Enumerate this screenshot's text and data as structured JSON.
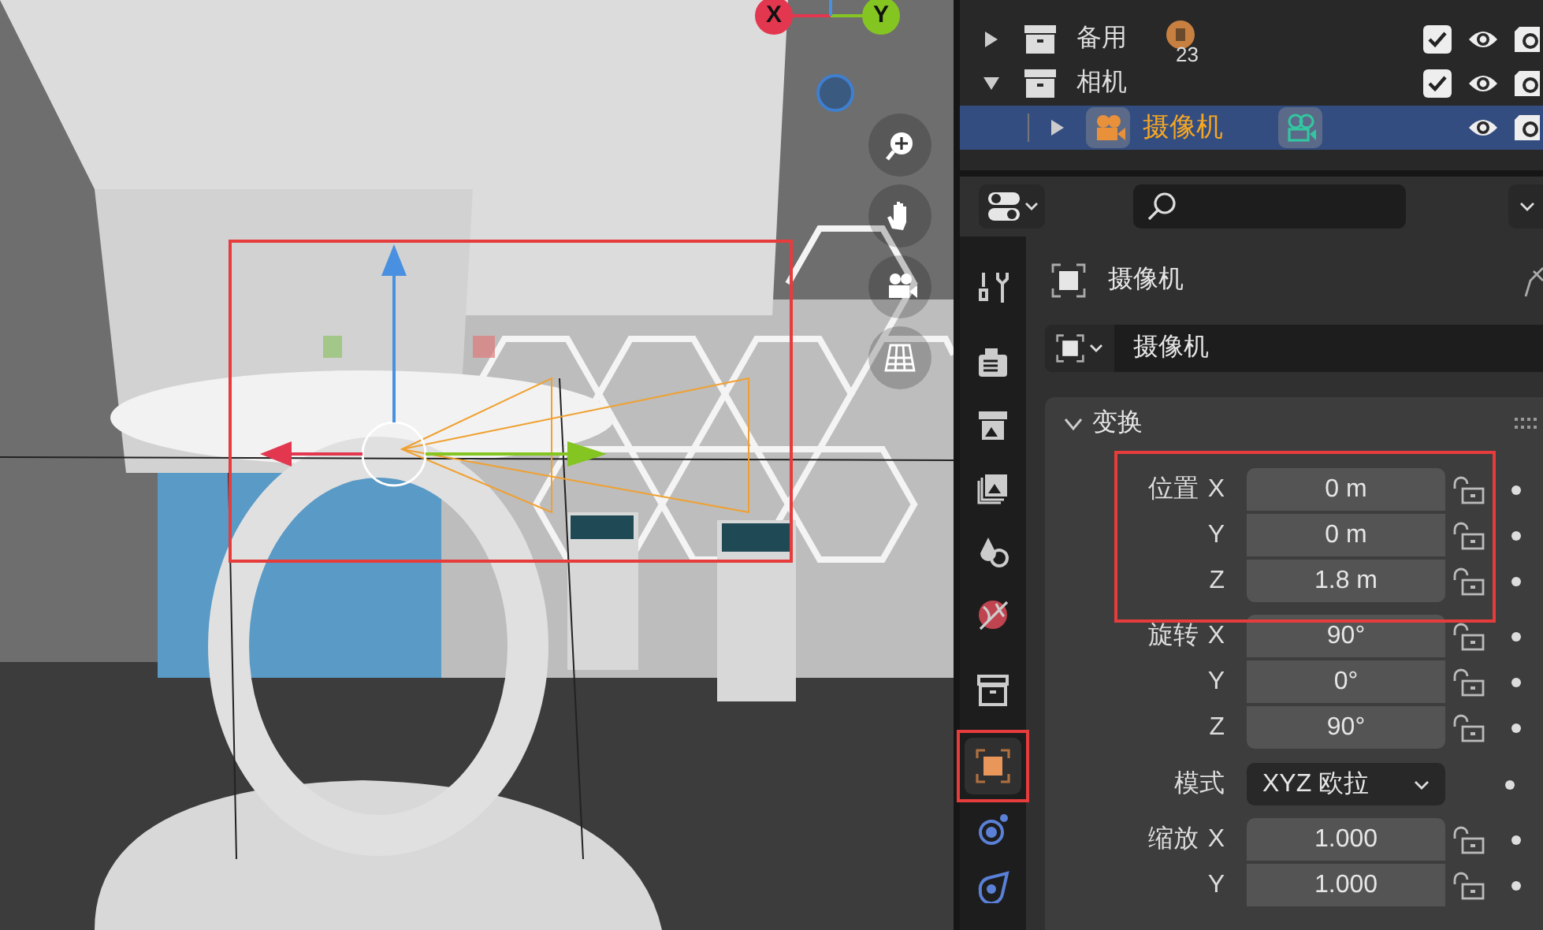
{
  "viewport": {
    "gizmo": [
      {
        "label": "X",
        "color": "#e2374f"
      },
      {
        "label": "Y",
        "color": "#84c522"
      }
    ]
  },
  "outliner": {
    "rows": [
      {
        "kind": "collection",
        "label": "备用",
        "expanded": false,
        "checked": true,
        "count": "23",
        "selected": false
      },
      {
        "kind": "collection",
        "label": "相机",
        "expanded": true,
        "checked": true,
        "selected": false
      },
      {
        "kind": "object",
        "label": "摄像机",
        "expanded": false,
        "selected": true
      }
    ]
  },
  "properties": {
    "tabs": [
      {
        "kind": "tool",
        "selected": false
      },
      {
        "kind": "render",
        "selected": false
      },
      {
        "kind": "output",
        "selected": false
      },
      {
        "kind": "view_layer",
        "selected": false
      },
      {
        "kind": "scene",
        "selected": false
      },
      {
        "kind": "world",
        "selected": false
      },
      {
        "kind": "collection",
        "selected": false
      },
      {
        "kind": "object",
        "selected": true
      },
      {
        "kind": "modifiers",
        "selected": false
      },
      {
        "kind": "physics",
        "selected": false
      }
    ],
    "object_name": "摄像机",
    "datablock_name": "摄像机",
    "transform": {
      "title": "变换",
      "expanded": true,
      "rows": [
        {
          "kind": "field",
          "label": "位置",
          "axis": "X",
          "value": "0 m"
        },
        {
          "kind": "field",
          "axis": "Y",
          "value": "0 m"
        },
        {
          "kind": "field",
          "axis": "Z",
          "value": "1.8 m"
        },
        {
          "kind": "field",
          "label": "旋转",
          "axis": "X",
          "value": "90°"
        },
        {
          "kind": "field",
          "axis": "Y",
          "value": "0°"
        },
        {
          "kind": "field",
          "axis": "Z",
          "value": "90°"
        },
        {
          "kind": "dropdown",
          "label": "模式",
          "value": "XYZ 欧拉"
        },
        {
          "kind": "field",
          "label": "缩放",
          "axis": "X",
          "value": "1.000"
        },
        {
          "kind": "field",
          "axis": "Y",
          "value": "1.000"
        }
      ]
    }
  }
}
